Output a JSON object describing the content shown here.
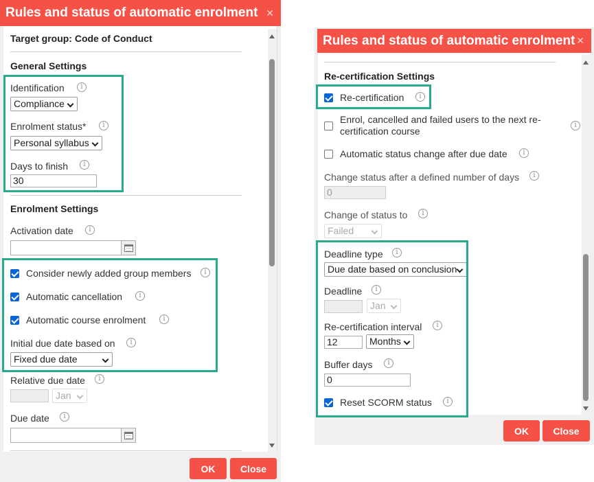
{
  "colors": {
    "accent": "#f55146",
    "highlight": "#2aa98d",
    "checkbox": "#0a66d6"
  },
  "left": {
    "title": "Rules and status of automatic enrolment",
    "target_group": "Target group: Code of Conduct",
    "general_heading": "General Settings",
    "identification_label": "Identification",
    "identification_value": "Compliance",
    "enrolment_status_label": "Enrolment status*",
    "enrolment_status_value": "Personal syllabus",
    "days_to_finish_label": "Days to finish",
    "days_to_finish_value": "30",
    "enrolment_heading": "Enrolment Settings",
    "activation_date_label": "Activation date",
    "activation_date_value": "",
    "consider_new_members": {
      "label": "Consider newly added group members",
      "checked": true
    },
    "automatic_cancellation": {
      "label": "Automatic cancellation",
      "checked": true
    },
    "automatic_course_enrolment": {
      "label": "Automatic course enrolment",
      "checked": true
    },
    "initial_due_label": "Initial due date based on",
    "initial_due_value": "Fixed due date",
    "relative_due_label": "Relative due date",
    "relative_due_month": "Jan",
    "due_date_label": "Due date",
    "due_date_value": "",
    "ok_label": "OK",
    "close_label": "Close"
  },
  "right": {
    "title": "Rules and status of automatic enrolment",
    "recert_heading": "Re-certification Settings",
    "recertification": {
      "label": "Re-certification",
      "checked": true
    },
    "enrol_cancelled": {
      "label_line1": "Enrol, cancelled and failed users to the next re-",
      "label_line2": "certification course",
      "checked": false
    },
    "auto_status_change": {
      "label": "Automatic status change after due date",
      "checked": false
    },
    "change_after_days_label": "Change status after a defined number of days",
    "change_after_days_value": "0",
    "change_status_to_label": "Change of status to",
    "change_status_to_value": "Failed",
    "deadline_type_label": "Deadline type",
    "deadline_type_value": "Due date based on conclusion",
    "deadline_label": "Deadline",
    "deadline_month": "Jan",
    "interval_label": "Re-certification interval",
    "interval_value": "12",
    "interval_unit": "Months",
    "buffer_days_label": "Buffer days",
    "buffer_days_value": "0",
    "reset_scorm": {
      "label": "Reset SCORM status",
      "checked": true
    },
    "ok_label": "OK",
    "close_label": "Close"
  }
}
